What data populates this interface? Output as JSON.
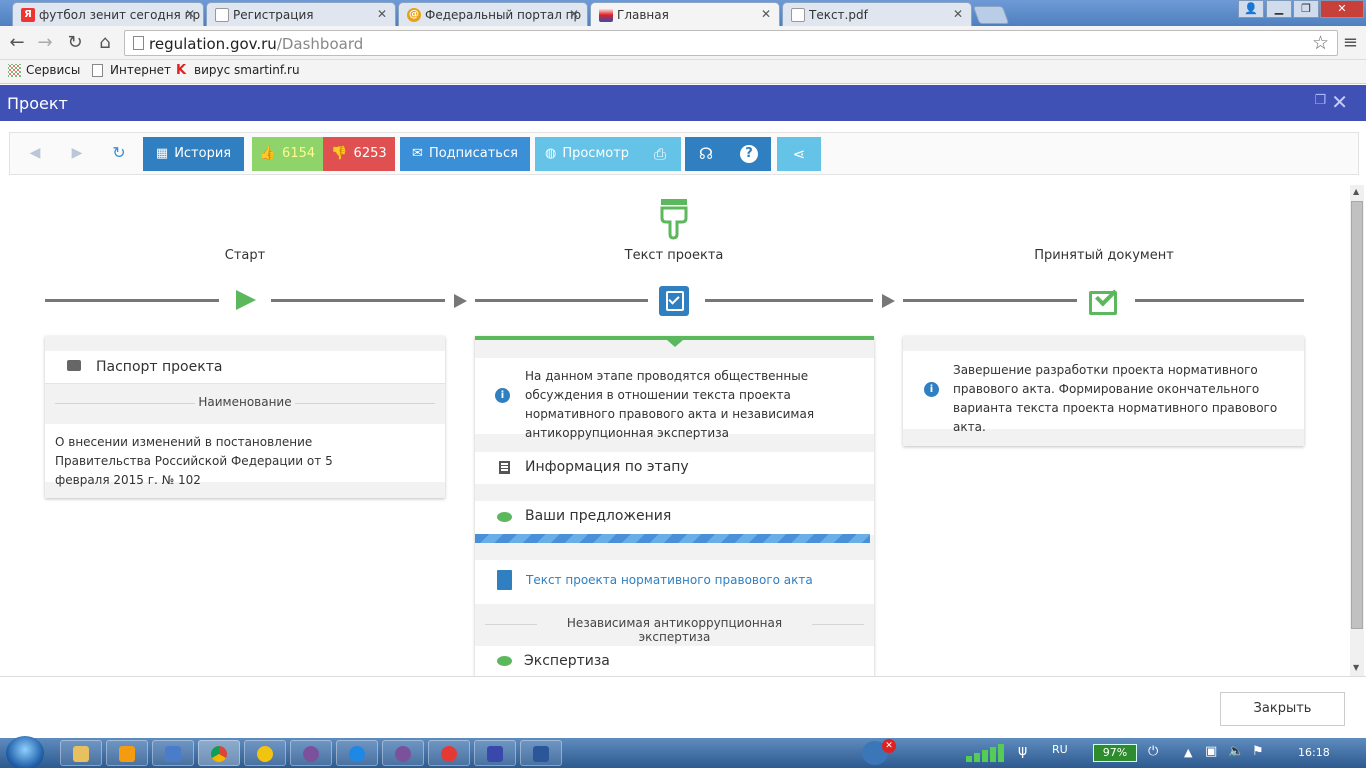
{
  "browser": {
    "tabs": [
      {
        "title": "футбол зенит сегодня пр",
        "icon": "yandex-icon",
        "active": false
      },
      {
        "title": "Регистрация",
        "icon": "page-icon",
        "active": false
      },
      {
        "title": "Федеральный портал пр",
        "icon": "at-icon",
        "active": false
      },
      {
        "title": "Главная",
        "icon": "emblem-icon",
        "active": true
      },
      {
        "title": "Текст.pdf",
        "icon": "page-icon",
        "active": false
      }
    ],
    "url_host": "regulation.gov.ru",
    "url_path": "/Dashboard",
    "bookmarks": [
      {
        "label": "Сервисы",
        "icon": "apps-icon"
      },
      {
        "label": "Интернет",
        "icon": "page-icon"
      },
      {
        "label": "вирус smartinf.ru",
        "icon": "kaspersky-icon"
      }
    ]
  },
  "modal": {
    "title": "Проект",
    "close_label": "Закрыть"
  },
  "toolbar": {
    "history_label": "История",
    "likes": "6154",
    "dislikes": "6253",
    "subscribe_label": "Подписаться",
    "preview_label": "Просмотр"
  },
  "stages": {
    "start": {
      "label": "Старт",
      "passport_label": "Паспорт проекта",
      "name_header": "Наименование",
      "name_text": "О внесении изменений в постановление Правительства Российской Федерации от 5 февраля 2015 г. № 102"
    },
    "text": {
      "label": "Текст проекта",
      "info_text": "На данном этапе проводятся общественные обсуждения в отношении текста проекта нормативного правового акта и независимая антикоррупционная экспертиза",
      "stage_info_label": "Информация по этапу",
      "proposals_label": "Ваши предложения",
      "doc_link": "Текст проекта нормативного правового акта",
      "expertise_header": "Независимая антикоррупционная экспертиза",
      "expertise_label": "Экспертиза"
    },
    "accepted": {
      "label": "Принятый документ",
      "info_text": "Завершение разработки проекта нормативного правового акта. Формирование окончательного варианта текста проекта нормативного правового акта."
    }
  },
  "taskbar": {
    "lang": "RU",
    "battery": "97%",
    "time": "16:18"
  },
  "colors": {
    "modal_header": "#3f51b5",
    "history": "#2f7fc1",
    "like": "#8fd46b",
    "dislike": "#e05050",
    "subscribe": "#3a8fd6",
    "preview": "#66c3e8",
    "green": "#5cb85c",
    "link": "#2f7fc1"
  }
}
